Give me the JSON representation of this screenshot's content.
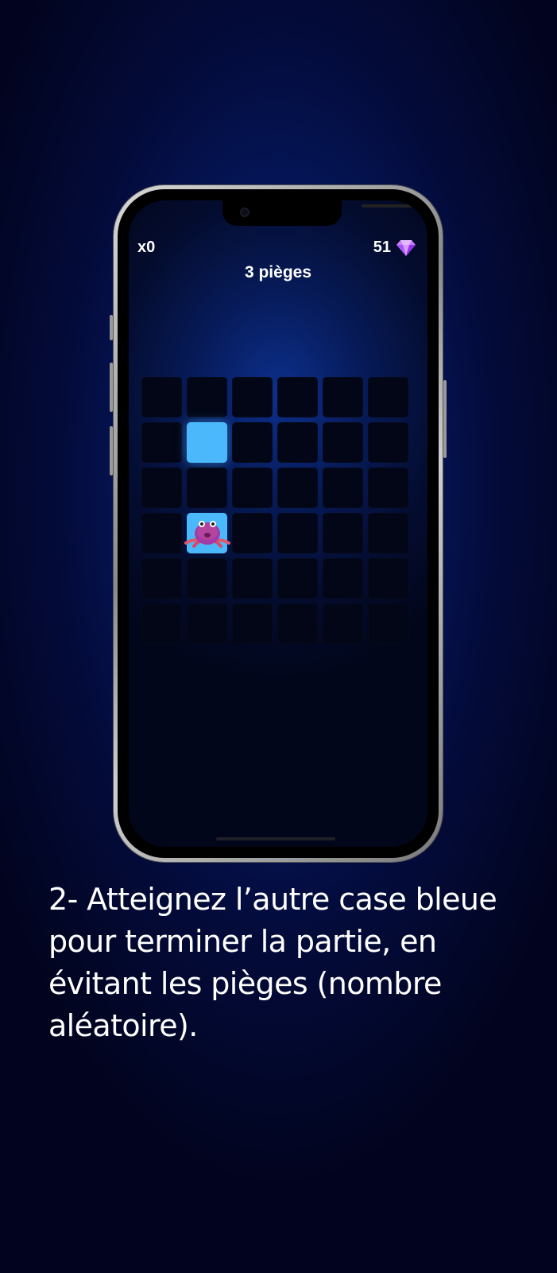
{
  "hud": {
    "multiplier": "x0",
    "gems_count": "51",
    "gem_icon": "gem-icon",
    "title": "3 pièges"
  },
  "board": {
    "rows": 6,
    "cols": 6,
    "target_cell": {
      "row": 2,
      "col": 2
    },
    "player_cell": {
      "row": 4,
      "col": 2
    },
    "colors": {
      "cell": "#020617",
      "highlight": "#4ab8fa",
      "gem": "#c77dff"
    }
  },
  "caption": {
    "text": "2- Atteignez l’autre case bleue pour terminer la partie, en évitant les pièges (nombre aléatoire)."
  }
}
